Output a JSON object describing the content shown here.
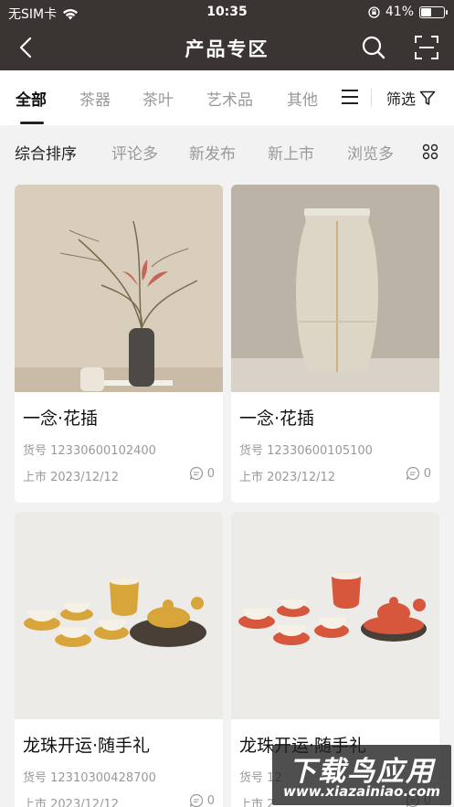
{
  "status_bar": {
    "carrier": "无SIM卡",
    "time": "10:35",
    "battery_percent": "41%",
    "battery_level": 0.41
  },
  "header": {
    "title": "产品专区",
    "icons": [
      "back-icon",
      "search-icon",
      "scan-icon"
    ]
  },
  "category_tabs": [
    {
      "label": "全部",
      "active": true
    },
    {
      "label": "茶器",
      "active": false
    },
    {
      "label": "茶叶",
      "active": false
    },
    {
      "label": "艺术品",
      "active": false
    },
    {
      "label": "其他",
      "active": false
    }
  ],
  "filter_label": "筛选",
  "sort_options": [
    {
      "label": "综合排序",
      "active": true
    },
    {
      "label": "评论多",
      "active": false
    },
    {
      "label": "新发布",
      "active": false
    },
    {
      "label": "新上市",
      "active": false
    },
    {
      "label": "浏览多",
      "active": false
    }
  ],
  "products": [
    {
      "name": "一念·花插",
      "sku": "货号 12330600102400",
      "date": "上市 2023/12/12",
      "comments": "0"
    },
    {
      "name": "一念·花插",
      "sku": "货号 12330600105100",
      "date": "上市 2023/12/12",
      "comments": "0"
    },
    {
      "name": "龙珠开运·随手礼",
      "sku": "货号 12310300428700",
      "date": "上市 2023/12/12",
      "comments": "0"
    },
    {
      "name": "龙珠开运·随手礼",
      "sku": "货号 12",
      "date": "上市 2",
      "comments": "0"
    }
  ],
  "watermark": {
    "big": "下载鸟应用",
    "small": "www.xiazainiao.com"
  },
  "colors": {
    "header_bg": "#3a3532",
    "page_bg": "#f2f2f2",
    "accent_text": "#111111",
    "muted_text": "#999999"
  }
}
